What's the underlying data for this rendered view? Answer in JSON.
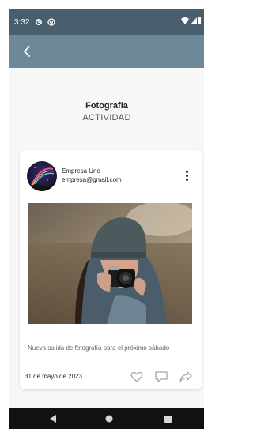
{
  "status_bar": {
    "time": "3:32",
    "icons": [
      "gear-icon",
      "at-icon",
      "wifi-icon",
      "signal-icon",
      "battery-icon"
    ]
  },
  "app_bar": {
    "back_icon": "back-arrow-icon",
    "color": "#6c8899"
  },
  "header": {
    "title": "Fotografía",
    "subtitle": "ACTIVIDAD"
  },
  "post": {
    "organizer_name": "Empresa Uno",
    "organizer_email": "empresa@gmail.com",
    "description": "Nueva salida de fotografía para el próximo sábado",
    "date": "31 de mayo de 2023",
    "actions": [
      "heart-icon",
      "comment-icon",
      "share-icon"
    ]
  },
  "nav_bar": {
    "buttons": [
      "back-nav-icon",
      "home-nav-icon",
      "recents-nav-icon"
    ]
  },
  "colors": {
    "status_bar": "#4a5f6d",
    "accent": "#6aa2c6",
    "icon_gray": "#a7a7a7"
  }
}
